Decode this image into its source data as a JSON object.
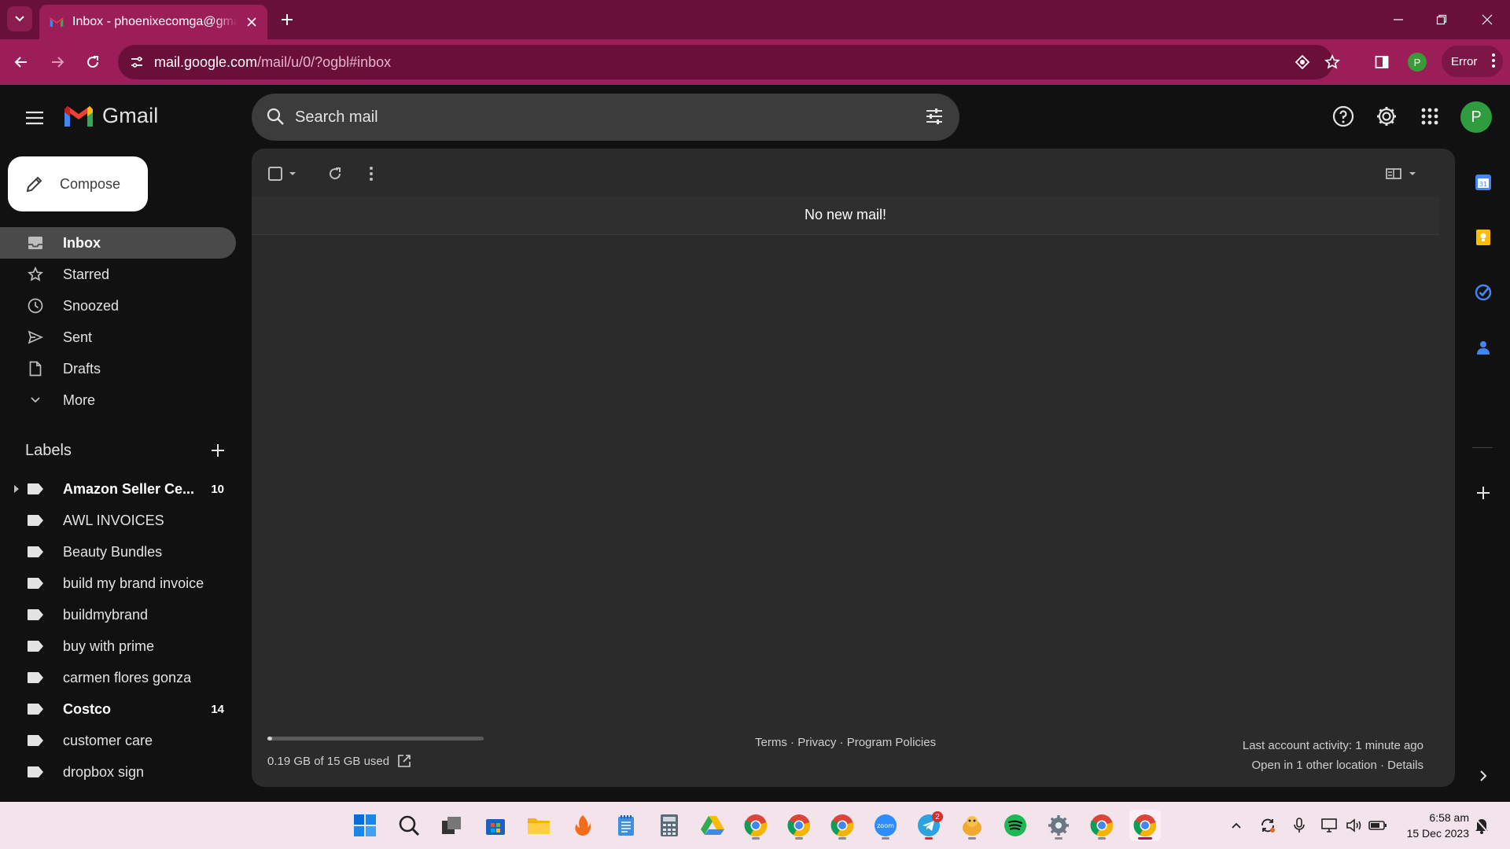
{
  "browser": {
    "tab_title": "Inbox - phoenixecomga@gmail.com - Gmail",
    "url_host": "mail.google.com",
    "url_path": "/mail/u/0/?ogbl#inbox",
    "profile_initial": "P",
    "error_label": "Error",
    "accent": "#9c1e59"
  },
  "header": {
    "logo_text": "Gmail",
    "search_placeholder": "Search mail",
    "avatar_initial": "P"
  },
  "compose_label": "Compose",
  "nav": [
    {
      "label": "Inbox",
      "icon": "inbox-icon",
      "active": true
    },
    {
      "label": "Starred",
      "icon": "star-icon"
    },
    {
      "label": "Snoozed",
      "icon": "clock-icon"
    },
    {
      "label": "Sent",
      "icon": "send-icon"
    },
    {
      "label": "Drafts",
      "icon": "draft-icon"
    },
    {
      "label": "More",
      "icon": "chevron-down-icon"
    }
  ],
  "labels_title": "Labels",
  "labels": [
    {
      "name": "Amazon Seller Ce...",
      "count": "10",
      "bold": true,
      "expandable": true
    },
    {
      "name": "AWL INVOICES"
    },
    {
      "name": "Beauty Bundles"
    },
    {
      "name": "build my brand invoice"
    },
    {
      "name": "buildmybrand"
    },
    {
      "name": "buy with prime"
    },
    {
      "name": "carmen flores gonza"
    },
    {
      "name": "Costco",
      "count": "14",
      "bold": true
    },
    {
      "name": "customer care"
    },
    {
      "name": "dropbox sign"
    }
  ],
  "main": {
    "empty_message": "No new mail!",
    "storage_text": "0.19 GB of 15 GB used",
    "storage_fraction": 0.013,
    "footer_terms": "Terms",
    "footer_privacy": "Privacy",
    "footer_policies": "Program Policies",
    "last_activity": "Last account activity: 1 minute ago",
    "other_location": "Open in 1 other location",
    "details": "Details"
  },
  "taskbar": {
    "time": "6:58 am",
    "date": "15 Dec 2023",
    "telegram_badge": "2"
  }
}
